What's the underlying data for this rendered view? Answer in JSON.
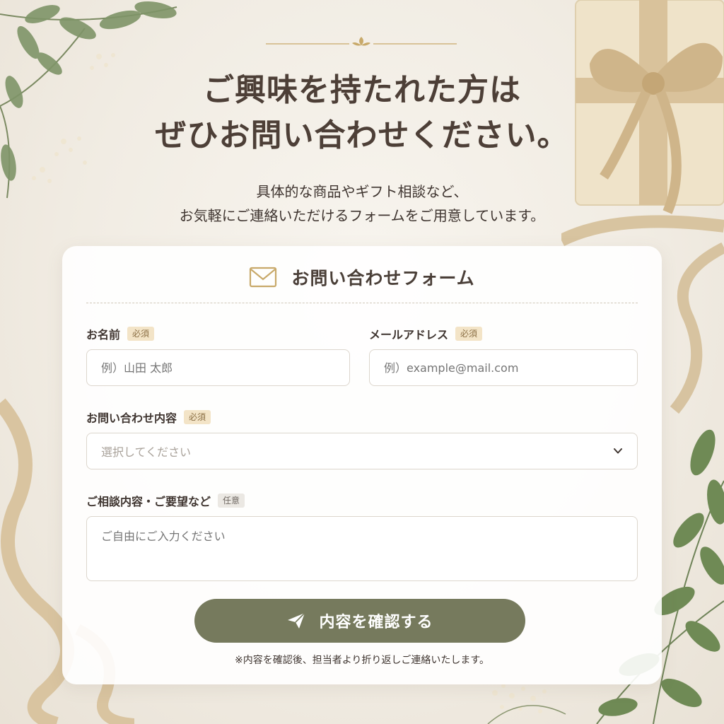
{
  "header": {
    "headline_line1": "ご興味を持たれた方は",
    "headline_line2": "ぜひお問い合わせください。",
    "sub_line1": "具体的な商品やギフト相談など、",
    "sub_line2": "お気軽にご連絡いただけるフォームをご用意しています。"
  },
  "form": {
    "title": "お問い合わせフォーム",
    "name": {
      "label": "お名前",
      "badge": "必須",
      "placeholder": "例）山田 太郎"
    },
    "email": {
      "label": "メールアドレス",
      "badge": "必須",
      "placeholder": "例）example@mail.com"
    },
    "inquiry_type": {
      "label": "お問い合わせ内容",
      "badge": "必須",
      "selected": "選択してください"
    },
    "message": {
      "label": "ご相談内容・ご要望など",
      "badge": "任意",
      "placeholder": "ご自由にご入力ください"
    },
    "submit_label": "内容を確認する",
    "note": "※内容を確認後、担当者より折り返しご連絡いたします。"
  },
  "colors": {
    "accent_olive": "#767a5d",
    "badge_required_bg": "#f3e4c7",
    "badge_optional_bg": "#ebe8e3",
    "gold": "#c8a96a"
  },
  "icons": [
    "envelope-icon",
    "chevron-down-icon",
    "paper-plane-icon"
  ]
}
